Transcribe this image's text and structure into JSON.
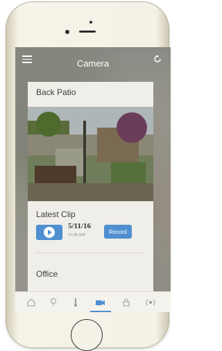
{
  "header": {
    "title": "Camera"
  },
  "cameras": [
    {
      "name": "Back Patio"
    },
    {
      "name": "Office"
    }
  ],
  "latest_clip": {
    "label": "Latest Clip",
    "date": "5/11/16",
    "time": "11:28 AM",
    "record_label": "Record"
  },
  "tabs": [
    {
      "icon": "home-icon"
    },
    {
      "icon": "lightbulb-icon"
    },
    {
      "icon": "thermometer-icon"
    },
    {
      "icon": "camera-icon",
      "active": true
    },
    {
      "icon": "lock-icon"
    },
    {
      "icon": "broadcast-icon"
    }
  ],
  "colors": {
    "accent": "#4f8ed0",
    "card": "#f0eee8"
  }
}
